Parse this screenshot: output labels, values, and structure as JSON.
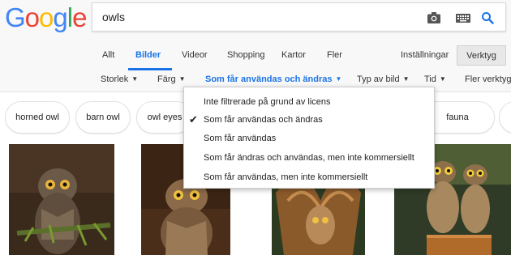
{
  "logo": {
    "letters": [
      "G",
      "o",
      "o",
      "g",
      "l",
      "e"
    ],
    "colors": [
      "#4285F4",
      "#EA4335",
      "#FBBC05",
      "#4285F4",
      "#34A853",
      "#EA4335"
    ]
  },
  "search": {
    "query": "owls",
    "icons": [
      "camera-icon",
      "keyboard-icon",
      "search-icon"
    ],
    "accent": "#1a73e8"
  },
  "tabs": {
    "all": "Allt",
    "images": "Bilder",
    "videos": "Videor",
    "shopping": "Shopping",
    "maps": "Kartor",
    "more": "Fler"
  },
  "toolbar": {
    "settings": "Inställningar",
    "tools": "Verktyg"
  },
  "filters": {
    "size": "Storlek",
    "color": "Färg",
    "usage": "Som får användas och ändras",
    "type": "Typ av bild",
    "time": "Tid",
    "more_tools": "Fler verktyg"
  },
  "chips": [
    "horned owl",
    "barn owl",
    "owl eyes",
    "fauna"
  ],
  "dropdown": {
    "items": [
      {
        "label": "Inte filtrerade på grund av licens",
        "checked": false
      },
      {
        "label": "Som får användas och ändras",
        "checked": true
      },
      {
        "label": "Som får användas",
        "checked": false
      },
      {
        "label": "Som får ändras och användas, men inte kommersiellt",
        "checked": false
      },
      {
        "label": "Som får användas, men inte kommersiellt",
        "checked": false
      }
    ],
    "check_glyph": "✔"
  },
  "thumbnails": [
    "owl-image-1",
    "owl-image-2",
    "owl-image-3",
    "owl-image-4"
  ]
}
